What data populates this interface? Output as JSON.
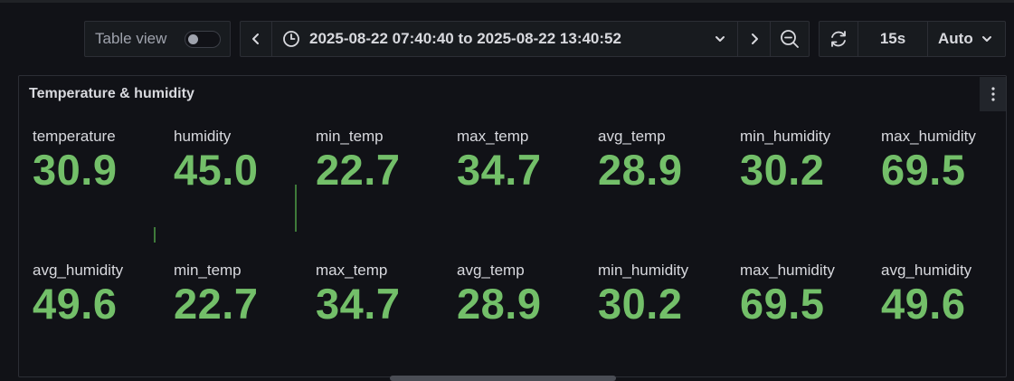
{
  "toolbar": {
    "table_view_label": "Table view",
    "time_range": "2025-08-22 07:40:40 to 2025-08-22 13:40:52",
    "refresh_interval": "15s",
    "auto_label": "Auto",
    "icons": [
      "chevron-left-icon",
      "clock-icon",
      "chevron-down-icon",
      "chevron-right-icon",
      "zoom-out-icon",
      "refresh-icon",
      "chevron-down-icon"
    ]
  },
  "panel": {
    "title": "Temperature & humidity",
    "value_color": "#73bf69",
    "rows": [
      [
        {
          "name": "temperature",
          "value": "30.9"
        },
        {
          "name": "humidity",
          "value": "45.0"
        },
        {
          "name": "min_temp",
          "value": "22.7"
        },
        {
          "name": "max_temp",
          "value": "34.7"
        },
        {
          "name": "avg_temp",
          "value": "28.9"
        },
        {
          "name": "min_humidity",
          "value": "30.2"
        },
        {
          "name": "max_humidity",
          "value": "69.5"
        }
      ],
      [
        {
          "name": "avg_humidity",
          "value": "49.6"
        },
        {
          "name": "min_temp",
          "value": "22.7"
        },
        {
          "name": "max_temp",
          "value": "34.7"
        },
        {
          "name": "avg_temp",
          "value": "28.9"
        },
        {
          "name": "min_humidity",
          "value": "30.2"
        },
        {
          "name": "max_humidity",
          "value": "69.5"
        },
        {
          "name": "avg_humidity",
          "value": "49.6"
        }
      ]
    ]
  }
}
